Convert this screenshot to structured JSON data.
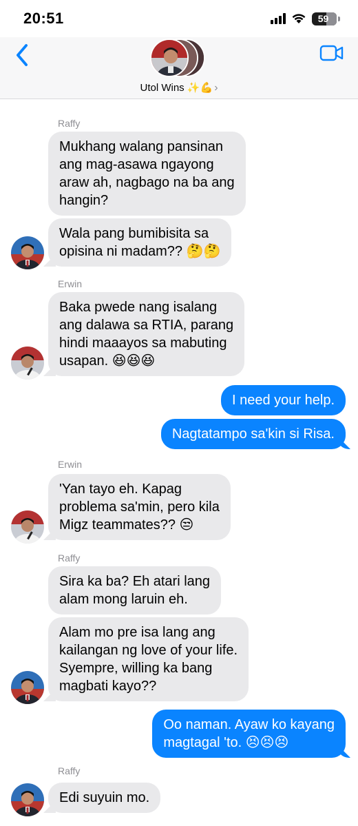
{
  "status_bar": {
    "time": "20:51",
    "battery": "59",
    "battery_level": 0.59
  },
  "header": {
    "group_name": "Utol Wins ✨💪",
    "chevron": "›",
    "back_icon": "chevron-left-icon",
    "video_icon": "video-camera-icon"
  },
  "colors": {
    "outgoing_bubble": "#0a84ff",
    "incoming_bubble": "#e9e9eb",
    "accent": "#0a84ff"
  },
  "messages": [
    {
      "sender": "Raffy",
      "text": "Mukhang walang pansinan\nang mag-asawa ngayong\naraw ah, nagbago na ba ang\nhangin?"
    },
    {
      "text": "Wala pang bumibisita sa\nopisina ni madam?? 🤔🤔"
    },
    {
      "sender": "Erwin",
      "text": "Baka pwede nang isalang\nang dalawa sa RTIA, parang\nhindi maaayos sa mabuting\nusapan. 😆😆😆"
    },
    {
      "text": "I need your help."
    },
    {
      "text": "Nagtatampo sa'kin si Risa."
    },
    {
      "sender": "Erwin",
      "text": "'Yan tayo eh. Kapag\nproblema sa'min, pero kila\nMigz teammates?? 😒"
    },
    {
      "sender": "Raffy",
      "text": "Sira ka ba? Eh atari lang\nalam mong laruin eh."
    },
    {
      "text": "Alam mo pre isa lang ang\nkailangan ng love of your life.\nSyempre, willing ka bang\nmagbati kayo??"
    },
    {
      "text": "Oo naman. Ayaw ko kayang\nmagtagal 'to. 😣😣😣"
    },
    {
      "sender": "Raffy",
      "text": "Edi suyuin mo."
    }
  ]
}
